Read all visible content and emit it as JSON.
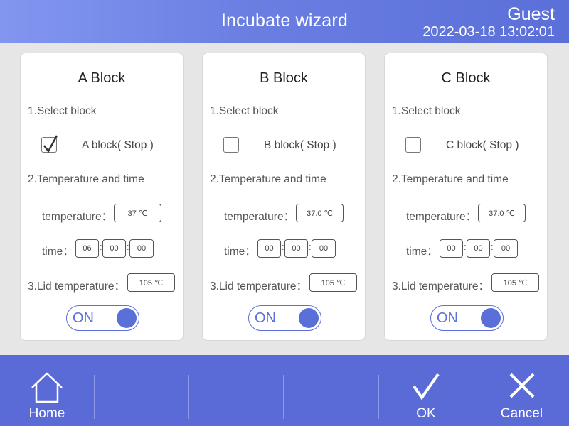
{
  "header": {
    "title": "Incubate wizard",
    "user": "Guest",
    "datetime": "2022-03-18 13:02:01"
  },
  "cards": [
    {
      "title": "A Block",
      "select_label": "1.Select block",
      "checked": true,
      "block_label": "A block( Stop )",
      "temp_section": "2.Temperature and time",
      "temperature_label": "temperature：",
      "temperature_value": "37 ℃",
      "time_label": "time：",
      "time_h": "06",
      "time_m": "00",
      "time_s": "00",
      "lid_label": "3.Lid temperature：",
      "lid_value": "105 ℃",
      "toggle": "ON"
    },
    {
      "title": "B Block",
      "select_label": "1.Select block",
      "checked": false,
      "block_label": "B block( Stop )",
      "temp_section": "2.Temperature and time",
      "temperature_label": "temperature：",
      "temperature_value": "37.0 ℃",
      "time_label": "time：",
      "time_h": "00",
      "time_m": "00",
      "time_s": "00",
      "lid_label": "3.Lid temperature：",
      "lid_value": "105 ℃",
      "toggle": "ON"
    },
    {
      "title": "C Block",
      "select_label": "1.Select block",
      "checked": false,
      "block_label": "C block( Stop )",
      "temp_section": "2.Temperature and time",
      "temperature_label": "temperature：",
      "temperature_value": "37.0 ℃",
      "time_label": "time：",
      "time_h": "00",
      "time_m": "00",
      "time_s": "00",
      "lid_label": "3.Lid temperature：",
      "lid_value": "105 ℃",
      "toggle": "ON"
    }
  ],
  "footer": {
    "home_label": "Home",
    "ok_label": "OK",
    "cancel_label": "Cancel"
  },
  "icons": {
    "home": "home-icon",
    "ok": "checkmark-icon",
    "cancel": "close-icon"
  },
  "colors": {
    "accent": "#5b6fd8",
    "header_gradient_start": "#8296f0",
    "header_gradient_end": "#5a6fd8",
    "footer": "#5a6ad6",
    "background": "#e6e6e6"
  }
}
